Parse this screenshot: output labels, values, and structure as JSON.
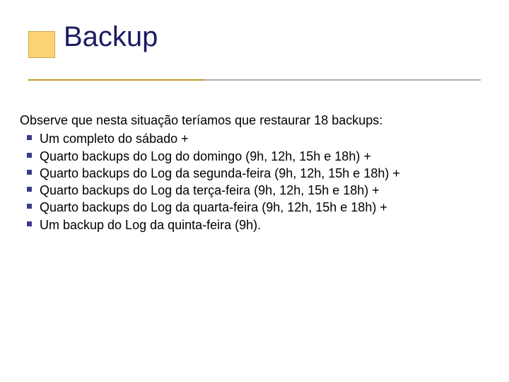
{
  "title": "Backup",
  "lead": "Observe que nesta situação teríamos que restaurar 18 backups:",
  "items": [
    "Um completo do sábado +",
    "Quarto backups do Log do domingo (9h, 12h, 15h e 18h) +",
    "Quarto backups do Log da segunda-feira (9h, 12h, 15h e 18h) +",
    "Quarto backups do Log da terça-feira (9h, 12h, 15h e 18h) +",
    "Quarto backups do Log da quarta-feira (9h, 12h, 15h e 18h) +",
    "Um backup do Log da quinta-feira (9h)."
  ]
}
